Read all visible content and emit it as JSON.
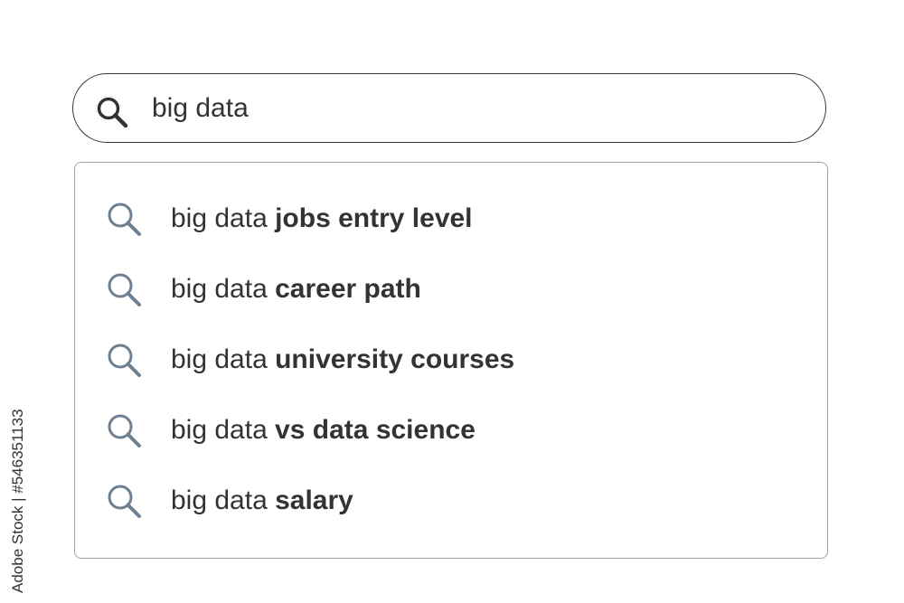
{
  "search": {
    "value": "big data",
    "icon": "search-icon"
  },
  "suggestions": [
    {
      "prefix": "big data ",
      "completion": "jobs entry level"
    },
    {
      "prefix": "big data ",
      "completion": "career path"
    },
    {
      "prefix": "big data ",
      "completion": "university courses"
    },
    {
      "prefix": "big data ",
      "completion": "vs data science"
    },
    {
      "prefix": "big data ",
      "completion": "salary"
    }
  ],
  "watermark": {
    "text": "Adobe Stock | #546351133"
  },
  "colors": {
    "text": "#333333",
    "border": "#333333",
    "dropdown_border": "#9aa6b2",
    "suggestion_icon": "#6e7f91"
  }
}
